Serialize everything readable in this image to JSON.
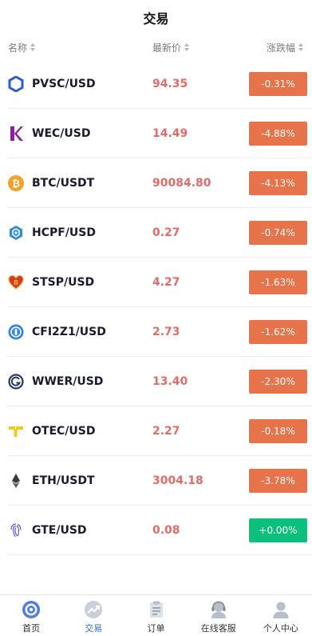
{
  "header": {
    "title": "交易"
  },
  "columns": {
    "name": "名称",
    "price": "最新价",
    "change": "涨跌幅"
  },
  "rows": [
    {
      "pair": "PVSC/USD",
      "price": "94.35",
      "change": "-0.31%",
      "icon": "hexagon-icon"
    },
    {
      "pair": "WEC/USD",
      "price": "14.49",
      "change": "-4.88%",
      "icon": "k-logo-icon"
    },
    {
      "pair": "BTC/USDT",
      "price": "90084.80",
      "change": "-4.13%",
      "icon": "bitcoin-icon"
    },
    {
      "pair": "HCPF/USD",
      "price": "0.27",
      "change": "-0.74%",
      "icon": "hex-gear-icon"
    },
    {
      "pair": "STSP/USD",
      "price": "4.27",
      "change": "-1.63%",
      "icon": "heart-b-icon"
    },
    {
      "pair": "CFI2Z1/USD",
      "price": "2.73",
      "change": "-1.62%",
      "icon": "c-coin-icon"
    },
    {
      "pair": "WWER/USD",
      "price": "13.40",
      "change": "-2.30%",
      "icon": "g-circle-icon"
    },
    {
      "pair": "OTEC/USD",
      "price": "2.27",
      "change": "-0.18%",
      "icon": "t-logo-icon"
    },
    {
      "pair": "ETH/USDT",
      "price": "3004.18",
      "change": "-3.78%",
      "icon": "ethereum-icon"
    },
    {
      "pair": "GTE/USD",
      "price": "0.08",
      "change": "+0.00%",
      "icon": "fingerprint-icon"
    }
  ],
  "tabbar": {
    "home": "首页",
    "trade": "交易",
    "orders": "订单",
    "service": "在线客服",
    "profile": "个人中心"
  },
  "colors": {
    "down": "#e7734a",
    "up": "#0bbf7d",
    "price": "#e56b68",
    "active_tab": "#2a6fd6"
  }
}
